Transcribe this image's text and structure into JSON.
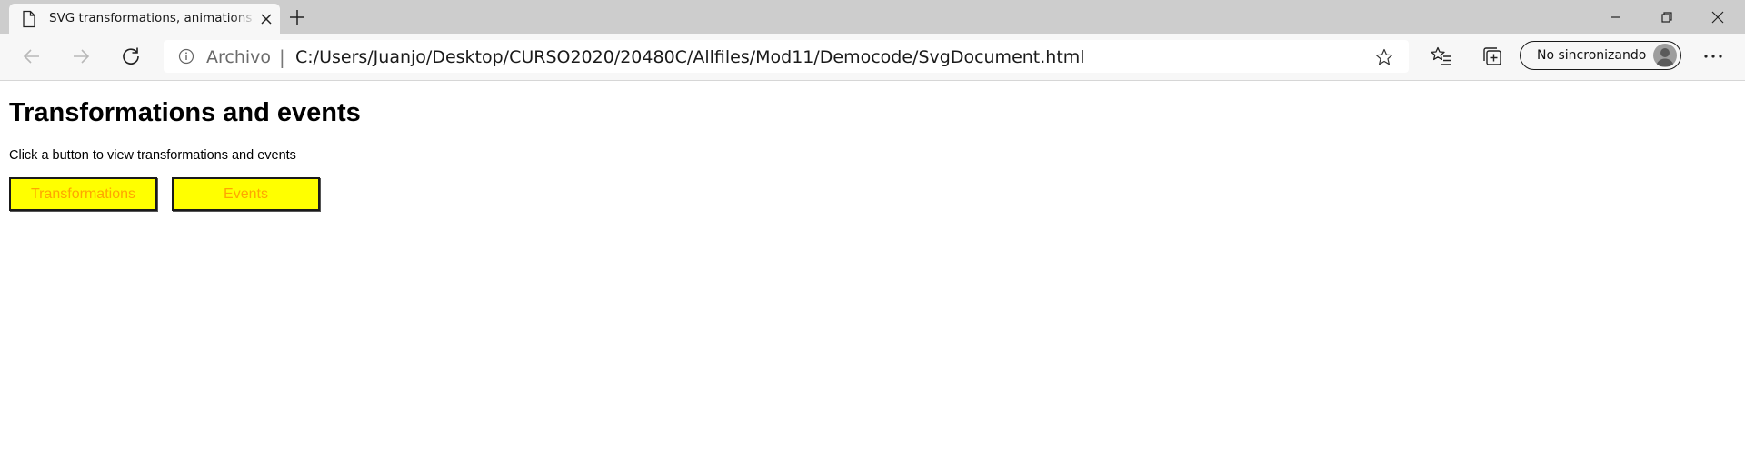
{
  "browser": {
    "tab": {
      "title": "SVG transformations, animations and events"
    },
    "address_bar": {
      "security_label": "Archivo",
      "separator": "|",
      "url": "C:/Users/Juanjo/Desktop/CURSO2020/20480C/Allfiles/Mod11/Democode/SvgDocument.html"
    },
    "profile": {
      "label": "No sincronizando"
    },
    "more_label": "···"
  },
  "page": {
    "title": "Transformations and events",
    "description": "Click a button to view transformations and events",
    "buttons": {
      "transformations": "Transformations",
      "events": "Events"
    }
  },
  "colors": {
    "button_background": "#ffff00",
    "button_text": "#ffa500",
    "tabstrip": "#cdcdcd",
    "toolbar": "#f7f7f7"
  }
}
